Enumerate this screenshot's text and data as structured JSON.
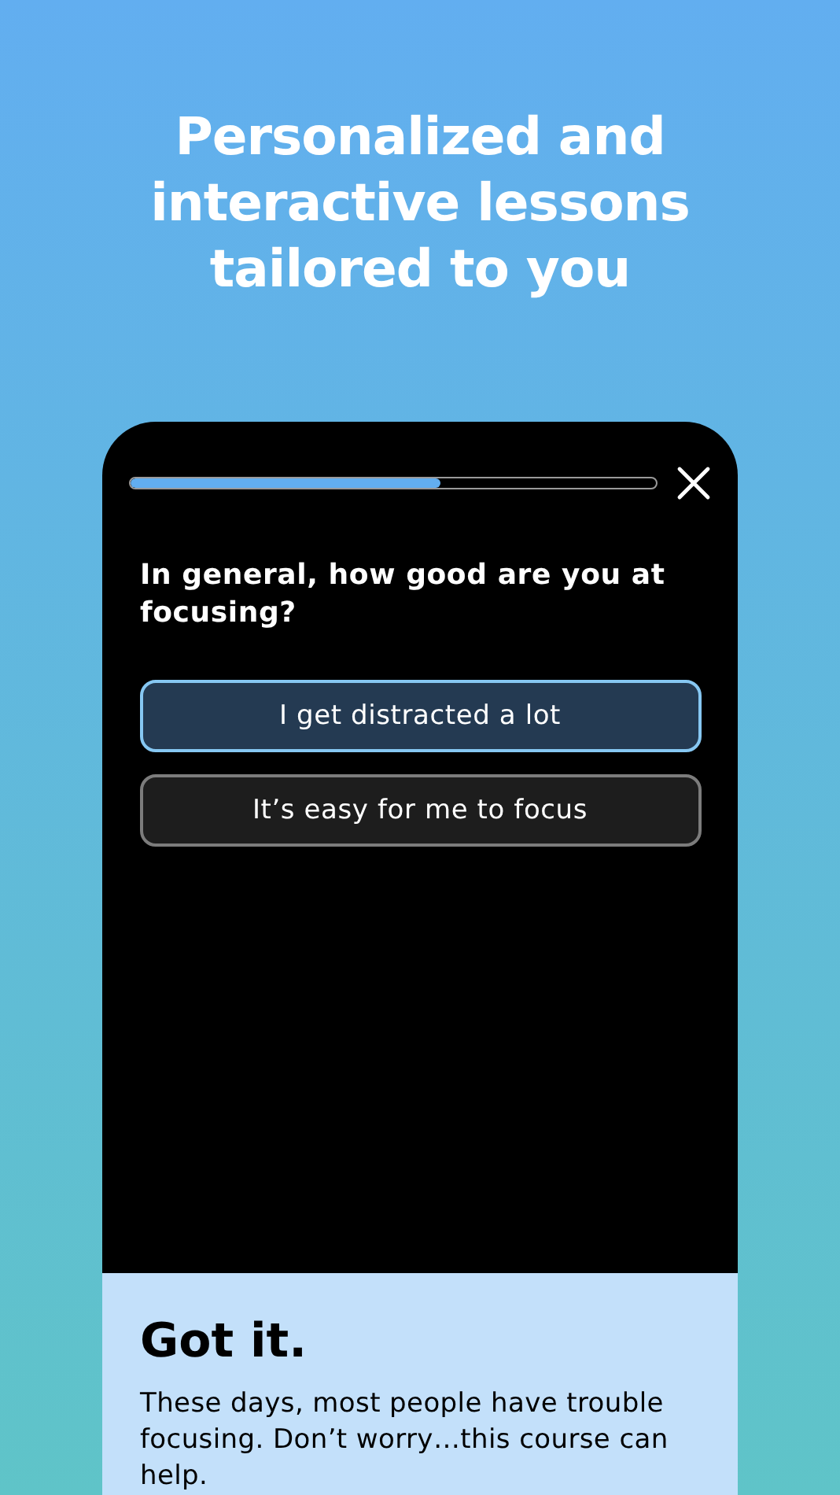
{
  "headline": "Personalized and interactive lessons tailored to you",
  "lesson": {
    "progress": {
      "level": 0.59
    },
    "question": "In general, how good are you at focusing?",
    "options": [
      {
        "label": "I get distracted a lot",
        "selected": true
      },
      {
        "label": "It’s easy for me to focus",
        "selected": false
      }
    ]
  },
  "feedback": {
    "title": "Got it.",
    "text": "These days, most people have trouble focusing. Don’t worry…this course can help."
  }
}
